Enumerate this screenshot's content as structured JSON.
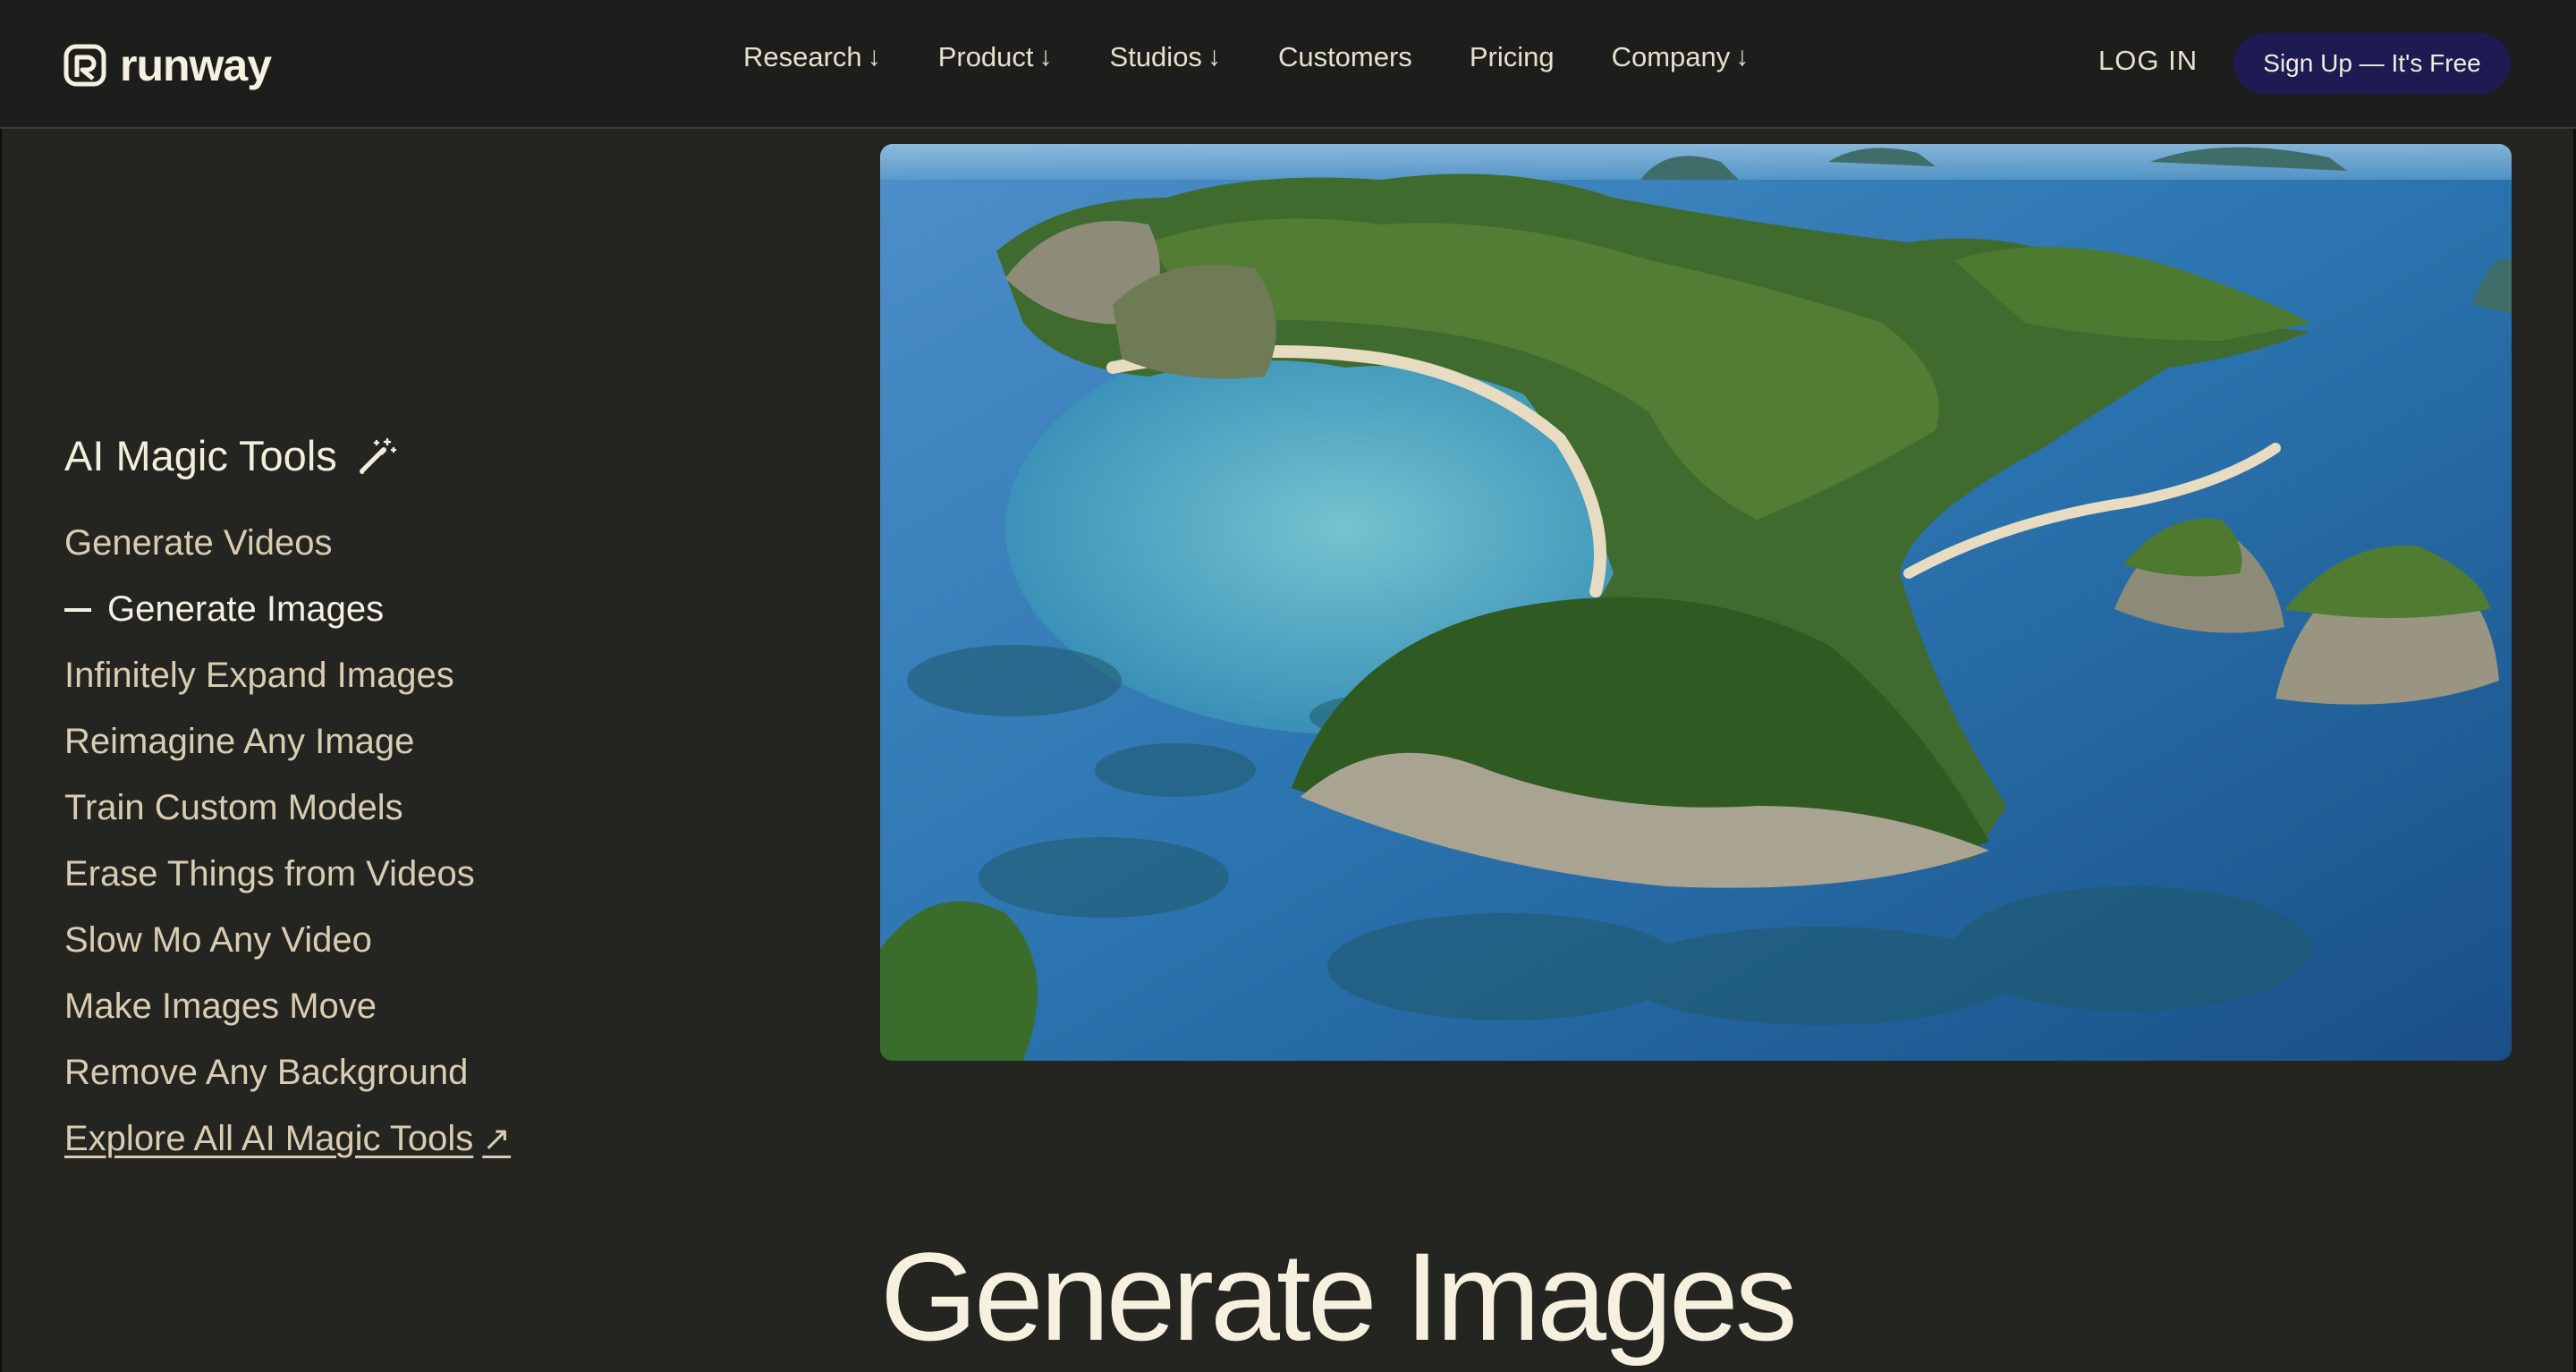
{
  "header": {
    "logo_text": "runway",
    "nav": [
      {
        "label": "Research",
        "has_dropdown": true
      },
      {
        "label": "Product",
        "has_dropdown": true
      },
      {
        "label": "Studios",
        "has_dropdown": true
      },
      {
        "label": "Customers",
        "has_dropdown": false
      },
      {
        "label": "Pricing",
        "has_dropdown": false
      },
      {
        "label": "Company",
        "has_dropdown": true
      }
    ],
    "dropdown_arrow": "↓",
    "login_label": "LOG IN",
    "signup_label": "Sign Up — It's Free"
  },
  "sidebar": {
    "title": "AI Magic Tools",
    "title_icon": "magic-wand-icon",
    "items": [
      {
        "label": "Generate Videos"
      },
      {
        "label": "Generate Images"
      },
      {
        "label": "Infinitely Expand Images"
      },
      {
        "label": "Reimagine Any Image"
      },
      {
        "label": "Train Custom Models"
      },
      {
        "label": "Erase Things from Videos"
      },
      {
        "label": "Slow Mo Any Video"
      },
      {
        "label": "Make Images Move"
      },
      {
        "label": "Remove Any Background"
      }
    ],
    "active_item": "Generate Images",
    "explore_label": "Explore All AI Magic Tools",
    "explore_icon": "↗"
  },
  "main": {
    "hero_image": "aerial-tropical-islands-image",
    "heading": "Generate Images"
  },
  "colors": {
    "background": "#242421",
    "header_bg": "#1d1d1b",
    "signup_bg": "#1e1b52",
    "text_primary": "#f4f0e2",
    "text_secondary": "#d8cdb1"
  }
}
